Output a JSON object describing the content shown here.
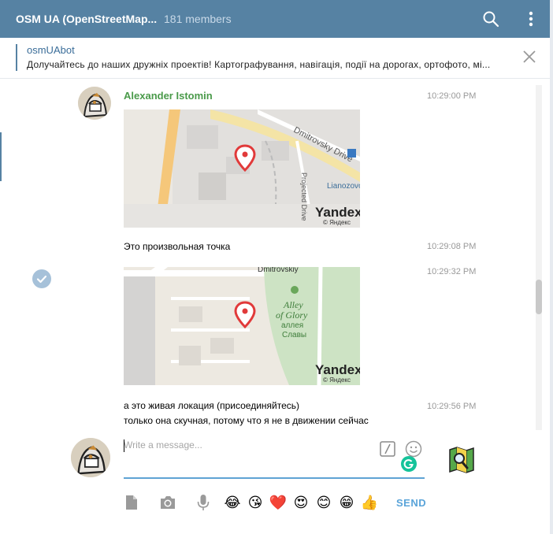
{
  "header": {
    "title": "OSM UA (OpenStreetMap...",
    "members": "181 members",
    "search_icon": "search-icon",
    "menu_icon": "more-vertical-icon",
    "bg_color": "#5682a3"
  },
  "pinned": {
    "name": "osmUAbot",
    "text": "Долучайтесь до наших дружніх проектів! Картографування, навігація, події на дорогах, ортофото, мі...",
    "close_icon": "close-icon"
  },
  "messages": {
    "sender": "Alexander Istomin",
    "sender_color": "#4a9a4a",
    "items": [
      {
        "time": "10:29:00 PM",
        "map": {
          "street": "Dmitrovsky Drive",
          "label1": "Lianozovo",
          "label2": "Projected Drive",
          "brand": "Yandex",
          "copyright": "© Яндекс"
        }
      },
      {
        "time": "10:29:08 PM",
        "text": "Это произвольная точка"
      },
      {
        "time": "10:29:32 PM",
        "map": {
          "street": "Dmitrovskiy",
          "park": "Alley of Glory",
          "park_ru": "аллея Славы",
          "brand": "Yandex",
          "copyright": "© Яндекс"
        }
      },
      {
        "time": "10:29:56 PM",
        "text1": "а это живая локация (присоединяйтесь)",
        "text2": "только она скучная, потому что я не в движении сейчас"
      }
    ]
  },
  "compose": {
    "placeholder": "Write a message...",
    "send_label": "SEND",
    "accent_color": "#5fa3d4",
    "toolbar_icons": [
      "document-icon",
      "camera-icon",
      "microphone-icon",
      "emoji-laughing-icon",
      "emoji-kiss-icon",
      "heart-icon",
      "emoji-heart-eyes-icon",
      "emoji-smile-icon",
      "emoji-grin-icon",
      "thumbs-up-icon"
    ],
    "emojis": [
      "😂",
      "😘",
      "❤️",
      "😍",
      "😊",
      "😁",
      "👍"
    ]
  }
}
